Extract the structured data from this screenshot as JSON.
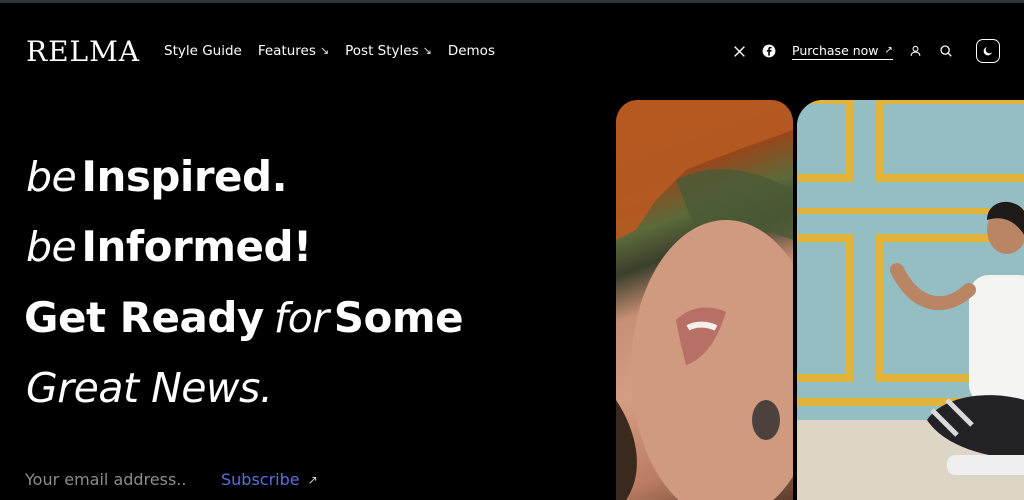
{
  "header": {
    "logo": "RELMA",
    "nav": [
      {
        "label": "Style Guide",
        "has_dropdown": false
      },
      {
        "label": "Features",
        "has_dropdown": true
      },
      {
        "label": "Post Styles",
        "has_dropdown": true
      },
      {
        "label": "Demos",
        "has_dropdown": false
      }
    ],
    "purchase_label": "Purchase now",
    "icons": [
      "x-icon",
      "facebook-icon",
      "user-icon",
      "search-icon",
      "moon-icon"
    ]
  },
  "hero": {
    "line1_thin": "be",
    "line1_bold": "Inspired.",
    "line2_thin": "be",
    "line2_bold": "Informed!",
    "line3_bold_a": "Get Ready",
    "line3_thin": "for",
    "line3_bold_b": "Some",
    "line4_thin": "Great News."
  },
  "newsletter": {
    "email_placeholder": "Your email address..",
    "subscribe_label": "Subscribe"
  },
  "colors": {
    "background": "#000000",
    "text": "#ffffff",
    "subscribe_accent": "#5b6ee1",
    "placeholder": "#8c8c8c"
  },
  "images": [
    {
      "name": "hero-portrait-image"
    },
    {
      "name": "hero-yoga-image"
    }
  ]
}
